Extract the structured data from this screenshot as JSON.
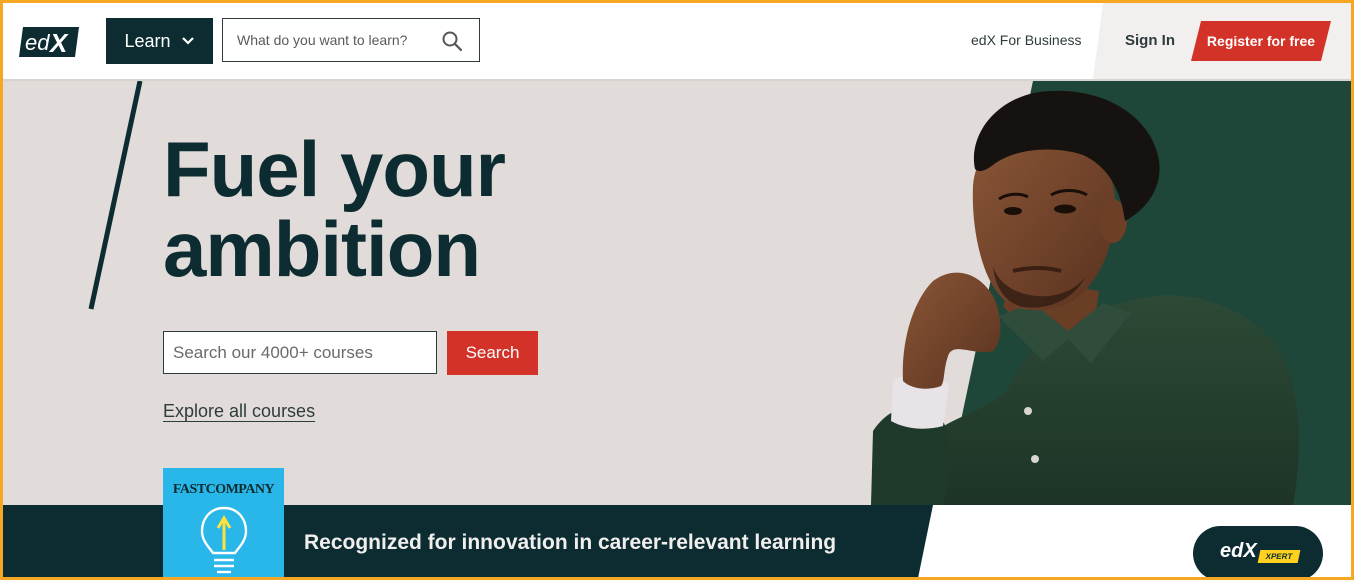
{
  "header": {
    "logo_text": "edX",
    "learn_label": "Learn",
    "search_placeholder": "What do you want to learn?",
    "business_link": "edX For Business",
    "signin_label": "Sign In",
    "register_label": "Register for free"
  },
  "hero": {
    "headline_line1": "Fuel your",
    "headline_line2": "ambition",
    "search_placeholder": "Search our 4000+ courses",
    "search_button": "Search",
    "explore_link": "Explore all courses"
  },
  "banner": {
    "badge_logo": "FASTCOMPANY",
    "text": "Recognized for innovation in career-relevant learning",
    "xpert_logo": "edX",
    "xpert_badge": "XPERT"
  },
  "colors": {
    "brand_dark": "#0d2c31",
    "accent_red": "#d23228",
    "hero_bg": "#e1dcd9",
    "hero_green": "#1e4639",
    "fastcompany_blue": "#29b6e8",
    "xpert_yellow": "#ffd21f"
  },
  "icons": {
    "learn_chevron": "chevron-down-icon",
    "search": "search-icon",
    "bulb": "lightbulb-icon"
  }
}
